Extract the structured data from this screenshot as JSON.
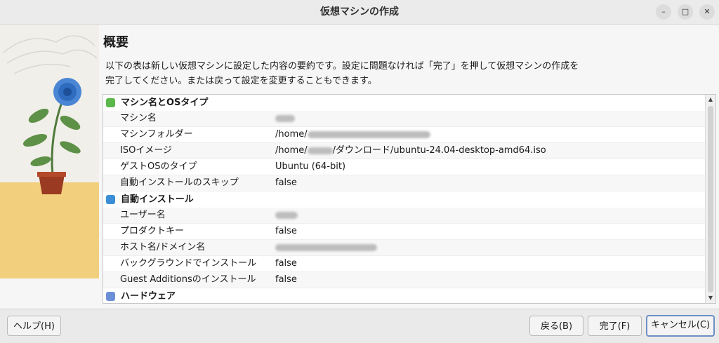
{
  "window": {
    "title": "仮想マシンの作成",
    "controls": [
      "–",
      "□",
      "✕"
    ]
  },
  "summary": {
    "heading": "概要",
    "desc_lines": [
      "以下の表は新しい仮想マシンに設定した内容の要約です。設定に問題なければ「完了」を押して仮想マシンの作成を",
      "完了してください。または戻って設定を変更することもできます。"
    ]
  },
  "sections": [
    {
      "title": "マシン名とOSタイプ",
      "rows": [
        {
          "label": "マシン名",
          "value": ""
        },
        {
          "label": "マシンフォルダー",
          "value": "/home/"
        },
        {
          "label": "ISOイメージ",
          "value_prefix": "/home/",
          "value_suffix": "/ダウンロード/ubuntu-24.04-desktop-amd64.iso"
        },
        {
          "label": "ゲストOSのタイプ",
          "value": "Ubuntu (64-bit)"
        },
        {
          "label": "自動インストールのスキップ",
          "value": "false"
        }
      ]
    },
    {
      "title": "自動インストール",
      "rows": [
        {
          "label": "ユーザー名",
          "value": ""
        },
        {
          "label": "プロダクトキー",
          "value": "false"
        },
        {
          "label": "ホスト名/ドメイン名",
          "value": ""
        },
        {
          "label": "バックグラウンドでインストール",
          "value": "false"
        },
        {
          "label": "Guest Additionsのインストール",
          "value": "false"
        }
      ]
    },
    {
      "title": "ハードウェア",
      "rows": []
    }
  ],
  "buttons": {
    "help": "ヘルプ(H)",
    "back": "戻る(B)",
    "finish": "完了(F)",
    "cancel": "キャンセル(C)"
  },
  "colors": {
    "accent_focus": "#6d8fc4",
    "section1_icon": "#5cb84a",
    "section2_icon": "#3a8fd6",
    "section3_icon": "#6d8fd8"
  }
}
